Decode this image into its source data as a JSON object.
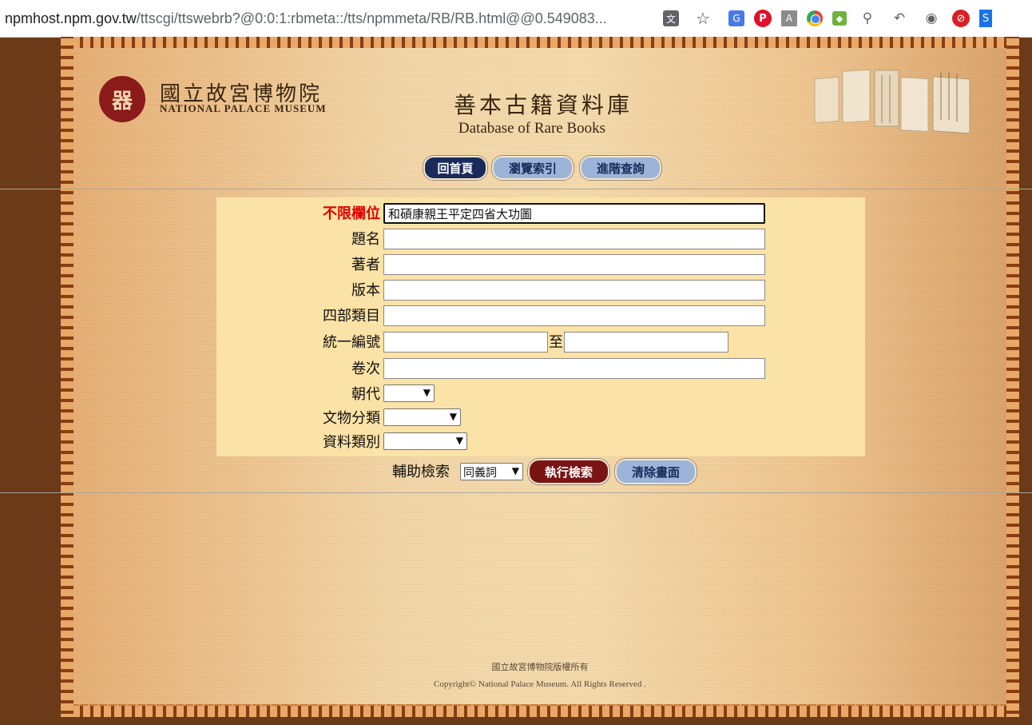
{
  "browser": {
    "url_host": "npmhost.npm.gov.tw",
    "url_path": "/ttscgi/ttswebrb?@0:0:1:rbmeta::/tts/npmmeta/RB/RB.html@@0.549083..."
  },
  "header": {
    "logo_seal": "器",
    "logo_zh": "國立故宮博物院",
    "logo_en": "NATIONAL PALACE MUSEUM",
    "title": "善本古籍資料庫",
    "subtitle": "Database of Rare Books"
  },
  "nav": {
    "home": "回首頁",
    "browse": "瀏覽索引",
    "advanced": "進階查詢"
  },
  "form": {
    "any_field_label": "不限欄位",
    "any_field_value": "和碩康親王平定四省大功圖",
    "title_label": "題名",
    "author_label": "著者",
    "edition_label": "版本",
    "category_label": "四部類目",
    "id_label": "統一編號",
    "id_to": "至",
    "volume_label": "卷次",
    "dynasty_label": "朝代",
    "artifact_label": "文物分類",
    "datatype_label": "資料類別"
  },
  "actions": {
    "aux_label": "輔助檢索",
    "aux_value": "同義詞",
    "search": "執行檢索",
    "clear": "清除畫面"
  },
  "footer": {
    "rights_zh": "國立故宮博物院版權所有",
    "rights_en": "Copyright© National Palace Museum. All Rights Reserved ."
  },
  "colors": {
    "frame_brown": "#6b3a18",
    "panel": "#fbe2a6",
    "label_red": "#e00000",
    "nav_dark": "#1a2a5a",
    "nav_light": "#9cb4d8",
    "search_red": "#7a1414"
  }
}
